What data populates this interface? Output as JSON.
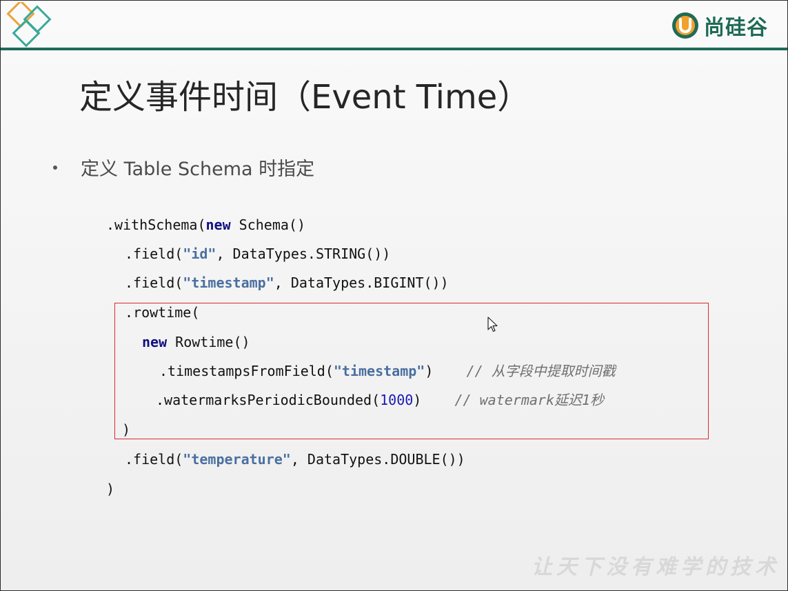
{
  "header": {
    "brand_name": "尚硅谷",
    "brand_color": "#1f6b57",
    "corner_logo_colors": [
      "#e9a43a",
      "#3aa99a"
    ]
  },
  "slide": {
    "title": "定义事件时间（Event Time）",
    "bullet": "定义 Table Schema 时指定",
    "code_lines": [
      [
        {
          "t": ".withSchema(",
          "c": ""
        },
        {
          "t": "new",
          "c": "kw"
        },
        {
          "t": " Schema()",
          "c": ""
        }
      ],
      [
        {
          "t": ".field(",
          "c": ""
        },
        {
          "t": "\"id\"",
          "c": "str"
        },
        {
          "t": ", DataTypes.STRING())",
          "c": ""
        }
      ],
      [
        {
          "t": ".field(",
          "c": ""
        },
        {
          "t": "\"timestamp\"",
          "c": "str"
        },
        {
          "t": ", DataTypes.BIGINT())",
          "c": ""
        }
      ],
      [
        {
          "t": ".rowtime(",
          "c": ""
        }
      ],
      [
        {
          "t": "new",
          "c": "kw"
        },
        {
          "t": " Rowtime()",
          "c": ""
        }
      ],
      [
        {
          "t": ".timestampsFromField(",
          "c": ""
        },
        {
          "t": "\"timestamp\"",
          "c": "str"
        },
        {
          "t": ")",
          "c": ""
        },
        {
          "t": "    // 从字段中提取时间戳",
          "c": "cm"
        }
      ],
      [
        {
          "t": ".watermarksPeriodicBounded(",
          "c": ""
        },
        {
          "t": "1000",
          "c": "num"
        },
        {
          "t": ")",
          "c": ""
        },
        {
          "t": "    // watermark延迟1秒",
          "c": "cm"
        }
      ],
      [
        {
          "t": ")",
          "c": ""
        }
      ],
      [
        {
          "t": ".field(",
          "c": ""
        },
        {
          "t": "\"temperature\"",
          "c": "str"
        },
        {
          "t": ", DataTypes.DOUBLE())",
          "c": ""
        }
      ],
      [
        {
          "t": ")",
          "c": ""
        }
      ]
    ],
    "highlight_color": "#d9292e"
  },
  "footer": {
    "watermark": "让天下没有难学的技术"
  }
}
